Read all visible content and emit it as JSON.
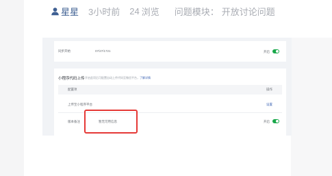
{
  "meta": {
    "author": "星星",
    "time": "3小时前",
    "views_count": "24",
    "views_label": "浏览",
    "module_label": "问题模块：",
    "module_value": "开放讨论问题"
  },
  "embedded": {
    "row_top": {
      "label": "同步开始",
      "value": "07/27/1721",
      "toggle_label": "开启"
    },
    "section": {
      "title": "小程序代码上传",
      "desc": "开启此项后可配置自动上传代码至微信平台，",
      "desc_link": "了解详情"
    },
    "table": {
      "header_left": "配置项",
      "header_right": "操作",
      "row1_label": "上传至小程序平台",
      "row1_action": "设置",
      "row2_label": "版本备注",
      "row2_value": "暂无可用信息",
      "row2_toggle": "开启"
    }
  },
  "colors": {
    "author": "#3e5f92",
    "meta_text": "#a9acb3",
    "toggle_on": "#1aa84b",
    "highlight_box": "#e53835"
  }
}
